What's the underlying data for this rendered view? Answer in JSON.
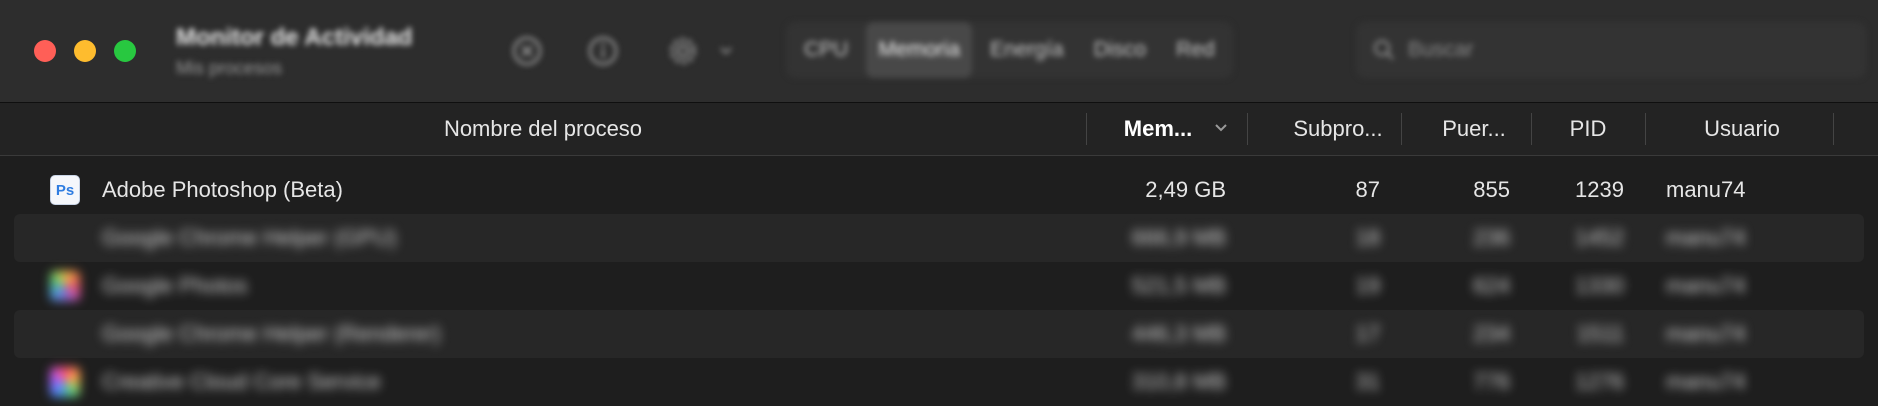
{
  "window": {
    "title": "Monitor de Actividad",
    "subtitle": "Mis procesos"
  },
  "toolbar": {
    "icons": [
      "close-process-icon",
      "info-icon",
      "gear-icon",
      "chevron-down-icon"
    ],
    "tabs": [
      "CPU",
      "Memoria",
      "Energía",
      "Disco",
      "Red"
    ],
    "active_tab": "Memoria",
    "search_placeholder": "Buscar"
  },
  "table": {
    "columns": [
      "Nombre del proceso",
      "Mem...",
      "Subpro...",
      "Puer...",
      "PID",
      "Usuario"
    ],
    "sorted_column": "Mem...",
    "rows": [
      {
        "name": "Adobe Photoshop (Beta)",
        "memory": "2,49 GB",
        "threads": "87",
        "ports": "855",
        "pid": "1239",
        "user": "manu74",
        "icon": "photoshop-icon"
      },
      {
        "name": "Google Chrome Helper (GPU)",
        "memory": "666,9 MB",
        "threads": "18",
        "ports": "236",
        "pid": "1452",
        "user": "manu74",
        "icon": ""
      },
      {
        "name": "Google Photos",
        "memory": "521,5 MB",
        "threads": "19",
        "ports": "624",
        "pid": "1330",
        "user": "manu74",
        "icon": "photos-app-icon"
      },
      {
        "name": "Google Chrome Helper (Renderer)",
        "memory": "446,3 MB",
        "threads": "17",
        "ports": "234",
        "pid": "1511",
        "user": "manu74",
        "icon": ""
      },
      {
        "name": "Creative Cloud Core Service",
        "memory": "310,8 MB",
        "threads": "31",
        "ports": "776",
        "pid": "1276",
        "user": "manu74",
        "icon": "creative-cloud-icon"
      }
    ]
  },
  "colors": {
    "toolbar_bg": "#2d2d2d",
    "window_bg": "#1e1e1e",
    "close": "#ff5f57",
    "minimize": "#febc2e",
    "maximize": "#28c840"
  }
}
